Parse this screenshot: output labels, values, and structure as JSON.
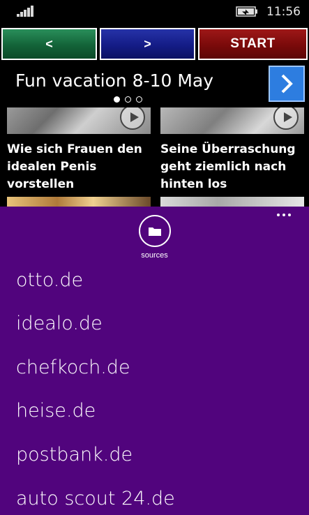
{
  "status": {
    "time": "11:56"
  },
  "nav": {
    "prev_label": "<",
    "next_label": ">",
    "start_label": "START"
  },
  "banner": {
    "title": "Fun vacation 8-10 May",
    "dot_count": 3,
    "active_dot": 0
  },
  "articles": [
    {
      "title": "Wie sich Frauen den idealen Penis vorstellen"
    },
    {
      "title": "Seine Überraschung geht ziemlich nach hinten los"
    }
  ],
  "appbar": {
    "sources_label": "sources",
    "background": "#51047d",
    "menu_items": [
      "otto.de",
      "idealo.de",
      "chefkoch.de",
      "heise.de",
      "postbank.de",
      "auto scout 24.de"
    ]
  },
  "colors": {
    "prev": "#136338",
    "next": "#141c86",
    "start": "#7a0a0a",
    "banner_arrow": "#2d7de0"
  }
}
